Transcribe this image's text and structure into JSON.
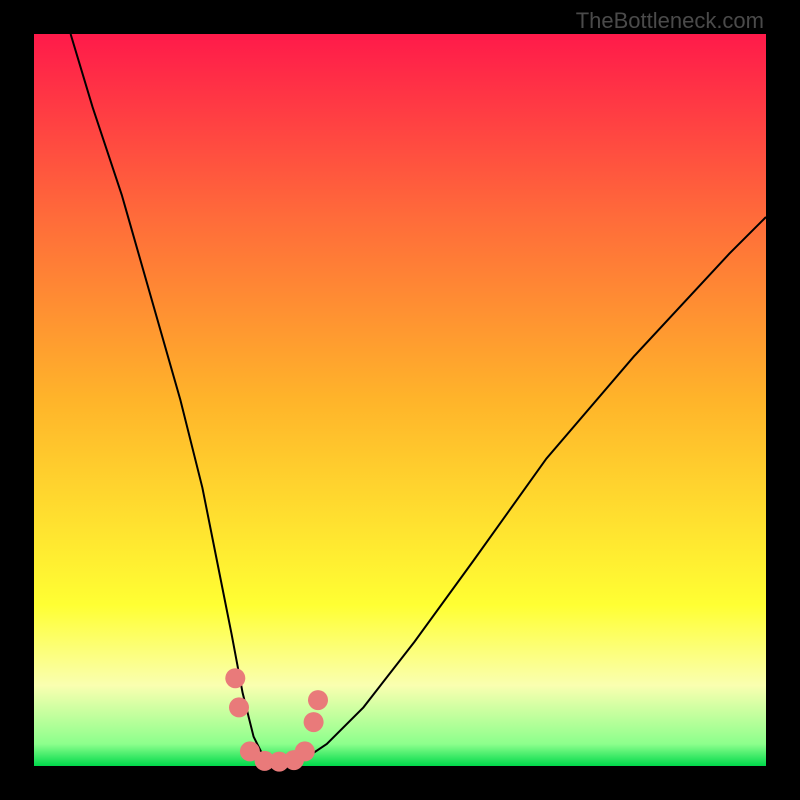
{
  "watermark": "TheBottleneck.com",
  "colors": {
    "frame": "#000000",
    "curve": "#000000",
    "marker": "#e97a7a",
    "gradient_stops": {
      "g0": "#ff1a4a",
      "g1": "#ff6b3a",
      "g2": "#ffb42a",
      "g3": "#ffff33",
      "g4": "#faffb0",
      "g5": "#8cff8c",
      "g6": "#00d94a"
    }
  },
  "chart_data": {
    "type": "line",
    "title": "",
    "xlabel": "",
    "ylabel": "",
    "xlim": [
      0,
      100
    ],
    "ylim": [
      0,
      100
    ],
    "grid": false,
    "legend": false,
    "series": [
      {
        "name": "bottleneck-curve",
        "x": [
          5,
          8,
          12,
          16,
          20,
          23,
          25,
          27,
          28.5,
          30,
          31.5,
          33,
          35,
          37,
          40,
          45,
          52,
          60,
          70,
          82,
          95,
          100
        ],
        "y": [
          100,
          90,
          78,
          64,
          50,
          38,
          28,
          18,
          10,
          4,
          1,
          0.5,
          0.5,
          1,
          3,
          8,
          17,
          28,
          42,
          56,
          70,
          75
        ]
      }
    ],
    "markers": {
      "name": "highlighted-points",
      "points": [
        {
          "x": 27.5,
          "y": 12
        },
        {
          "x": 28.0,
          "y": 8
        },
        {
          "x": 29.5,
          "y": 2
        },
        {
          "x": 31.5,
          "y": 0.7
        },
        {
          "x": 33.5,
          "y": 0.6
        },
        {
          "x": 35.5,
          "y": 0.8
        },
        {
          "x": 37.0,
          "y": 2
        },
        {
          "x": 38.2,
          "y": 6
        },
        {
          "x": 38.8,
          "y": 9
        }
      ]
    }
  }
}
